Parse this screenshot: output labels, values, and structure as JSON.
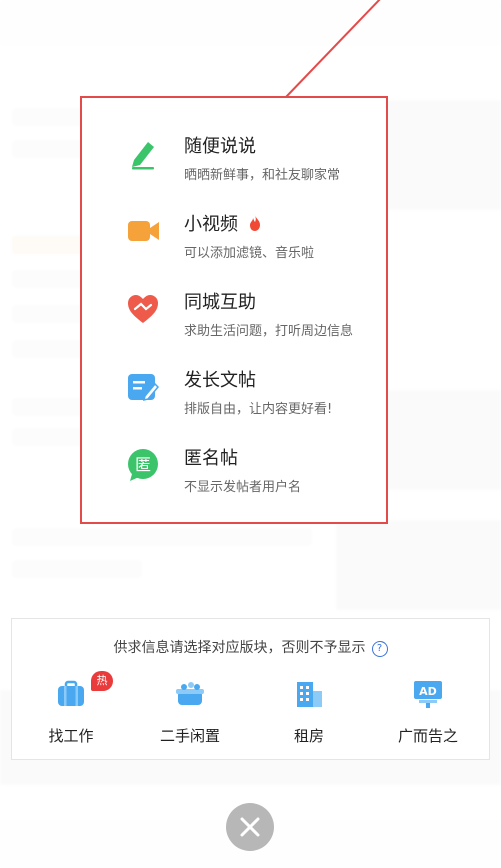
{
  "popup": {
    "items": [
      {
        "title": "随便说说",
        "desc": "晒晒新鲜事，和社友聊家常",
        "icon": "pencil-icon"
      },
      {
        "title": "小视频",
        "desc": "可以添加滤镜、音乐啦",
        "icon": "video-camera-icon",
        "hot_icon": "fire-icon"
      },
      {
        "title": "同城互助",
        "desc": "求助生活问题，打听周边信息",
        "icon": "helping-heart-icon"
      },
      {
        "title": "发长文帖",
        "desc": "排版自由，让内容更好看!",
        "icon": "edit-document-icon"
      },
      {
        "title": "匿名帖",
        "desc": "不显示发帖者用户名",
        "icon": "anonymous-badge-icon",
        "badge_char": "匿"
      }
    ]
  },
  "categories": {
    "notice": "供求信息请选择对应版块，否则不予显示",
    "items": [
      {
        "label": "找工作",
        "icon": "briefcase-icon",
        "badge": "热"
      },
      {
        "label": "二手闲置",
        "icon": "basket-icon"
      },
      {
        "label": "租房",
        "icon": "building-icon"
      },
      {
        "label": "广而告之",
        "icon": "ad-board-icon",
        "ad_text": "AD"
      }
    ]
  },
  "colors": {
    "accent_red": "#e34b4b",
    "green": "#3cc46b",
    "orange": "#f6a23a",
    "red": "#ee5b4b",
    "blue": "#49a8ef"
  }
}
